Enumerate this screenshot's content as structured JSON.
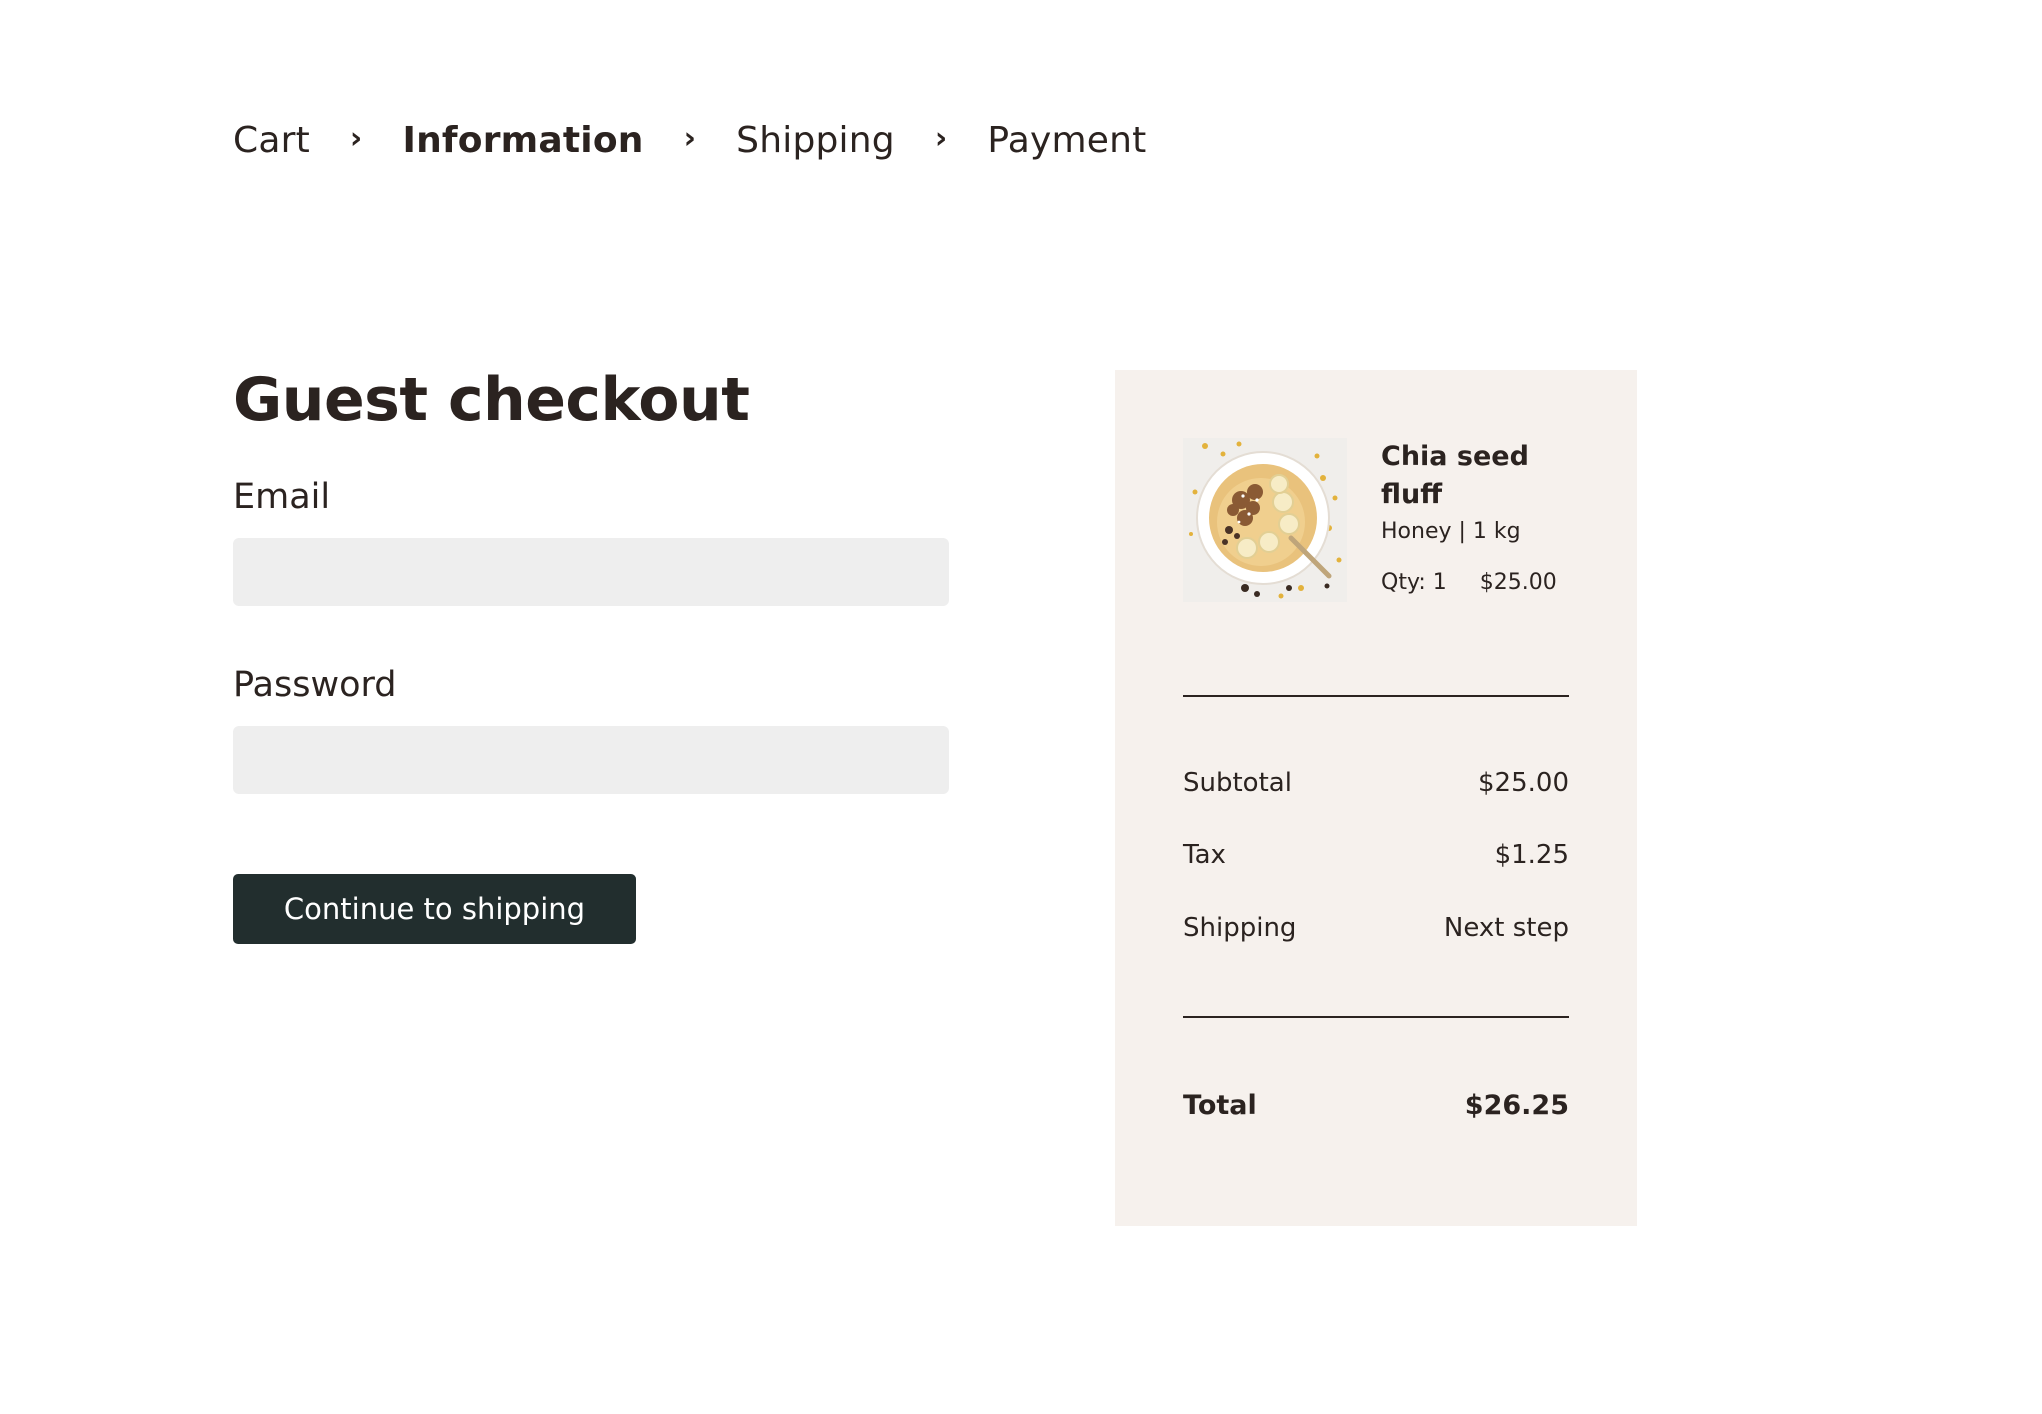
{
  "breadcrumb": {
    "steps": [
      {
        "label": "Cart"
      },
      {
        "label": "Information",
        "active": true
      },
      {
        "label": "Shipping"
      },
      {
        "label": "Payment"
      }
    ],
    "separator": "›"
  },
  "checkout": {
    "title": "Guest checkout",
    "email": {
      "label": "Email",
      "value": "",
      "placeholder": ""
    },
    "password": {
      "label": "Password",
      "value": "",
      "placeholder": ""
    },
    "continue_label": "Continue to shipping"
  },
  "summary": {
    "product": {
      "name": "Chia seed fluff",
      "variant": "Honey | 1 kg",
      "qty": "Qty: 1",
      "price": "$25.00",
      "image_icon": "oatmeal-bowl-photo"
    },
    "rows": {
      "subtotal": {
        "label": "Subtotal",
        "value": "$25.00"
      },
      "tax": {
        "label": "Tax",
        "value": "$1.25"
      },
      "shipping": {
        "label": "Shipping",
        "value": "Next step"
      },
      "total": {
        "label": "Total",
        "value": "$26.25"
      }
    }
  },
  "colors": {
    "text": "#2b2320",
    "button": "#222e2e",
    "input_bg": "#eeeeee",
    "panel_bg": "#f6f1ed"
  }
}
